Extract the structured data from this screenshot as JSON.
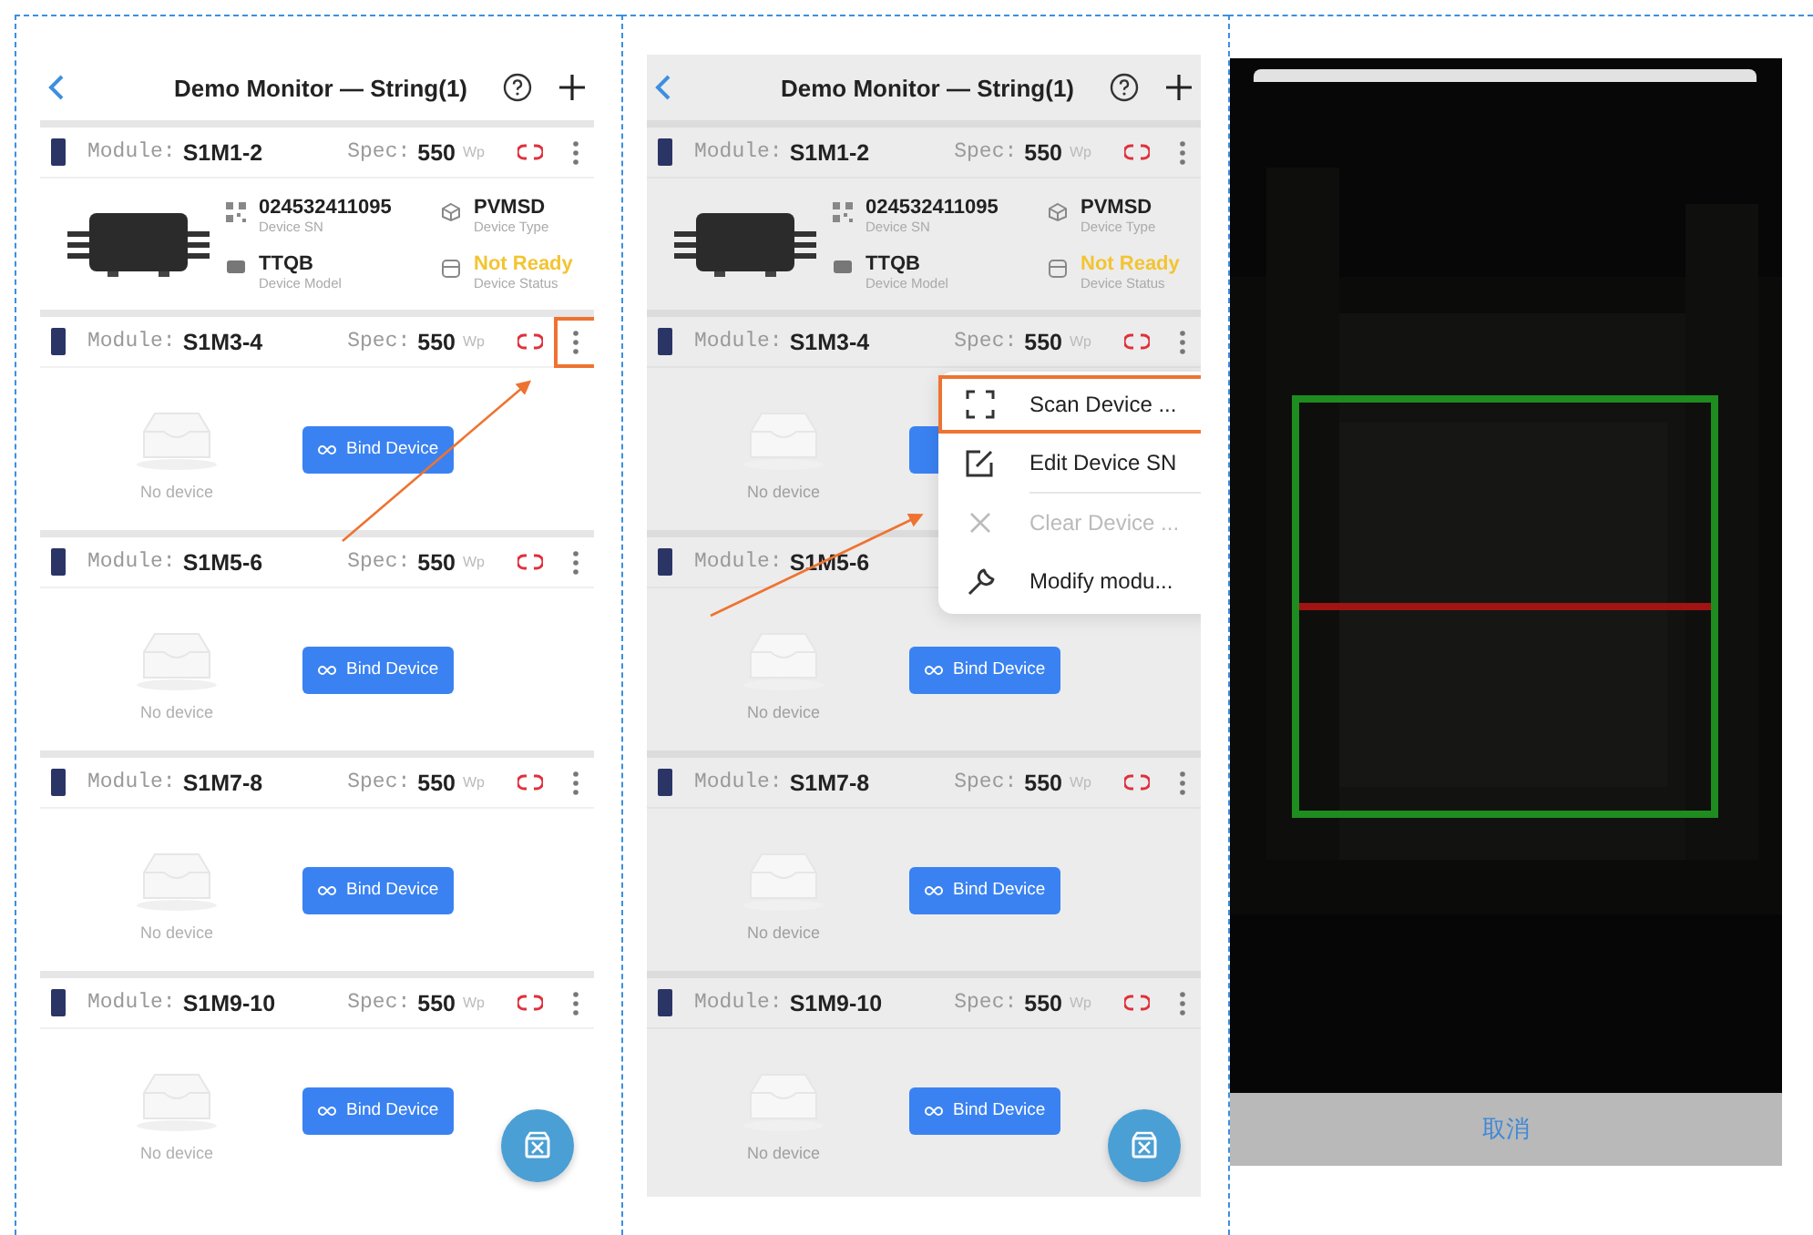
{
  "screens": [
    {
      "kind": "list",
      "title": "Demo Monitor — String(1)",
      "dimmed": false,
      "modules": [
        {
          "label": "Module:",
          "name": "S1M1-2",
          "spec_label": "Spec:",
          "spec": "550",
          "unit": "Wp",
          "bound": true,
          "annotated": false,
          "details": [
            {
              "kind": "sn",
              "value": "024532411095",
              "label": "Device SN",
              "color": "#222222"
            },
            {
              "kind": "type",
              "value": "PVMSD",
              "label": "Device Type",
              "color": "#222222"
            },
            {
              "kind": "model",
              "value": "TTQB",
              "label": "Device Model",
              "color": "#222222"
            },
            {
              "kind": "status",
              "value": "Not Ready",
              "label": "Device Status",
              "color": "#f3c433"
            }
          ]
        },
        {
          "label": "Module:",
          "name": "S1M3-4",
          "spec_label": "Spec:",
          "spec": "550",
          "unit": "Wp",
          "bound": false,
          "annotated": true,
          "empty_text": "No device",
          "bind_label": "Bind Device"
        },
        {
          "label": "Module:",
          "name": "S1M5-6",
          "spec_label": "Spec:",
          "spec": "550",
          "unit": "Wp",
          "bound": false,
          "annotated": false,
          "empty_text": "No device",
          "bind_label": "Bind Device"
        },
        {
          "label": "Module:",
          "name": "S1M7-8",
          "spec_label": "Spec:",
          "spec": "550",
          "unit": "Wp",
          "bound": false,
          "annotated": false,
          "empty_text": "No device",
          "bind_label": "Bind Device"
        },
        {
          "label": "Module:",
          "name": "S1M9-10",
          "spec_label": "Spec:",
          "spec": "550",
          "unit": "Wp",
          "bound": false,
          "annotated": false,
          "empty_text": "No device",
          "bind_label": "Bind Device"
        }
      ]
    },
    {
      "kind": "list",
      "title": "Demo Monitor — String(1)",
      "dimmed": true,
      "modules": [
        {
          "label": "Module:",
          "name": "S1M1-2",
          "spec_label": "Spec:",
          "spec": "550",
          "unit": "Wp",
          "bound": true,
          "annotated": false,
          "details": [
            {
              "kind": "sn",
              "value": "024532411095",
              "label": "Device SN",
              "color": "#222222"
            },
            {
              "kind": "type",
              "value": "PVMSD",
              "label": "Device Type",
              "color": "#222222"
            },
            {
              "kind": "model",
              "value": "TTQB",
              "label": "Device Model",
              "color": "#222222"
            },
            {
              "kind": "status",
              "value": "Not Ready",
              "label": "Device Status",
              "color": "#f3c433"
            }
          ]
        },
        {
          "label": "Module:",
          "name": "S1M3-4",
          "spec_label": "Spec:",
          "spec": "550",
          "unit": "Wp",
          "bound": false,
          "annotated": false,
          "empty_text": "No device"
        },
        {
          "label": "Module:",
          "name": "S1M5-6",
          "bound": false,
          "empty_text": "No device",
          "bind_label": "Bind Device"
        },
        {
          "label": "Module:",
          "name": "S1M7-8",
          "spec_label": "Spec:",
          "spec": "550",
          "unit": "Wp",
          "bound": false,
          "annotated": false,
          "empty_text": "No device",
          "bind_label": "Bind Device"
        },
        {
          "label": "Module:",
          "name": "S1M9-10",
          "spec_label": "Spec:",
          "spec": "550",
          "unit": "Wp",
          "bound": false,
          "annotated": false,
          "empty_text": "No device",
          "bind_label": "Bind Device"
        }
      ],
      "menu": [
        {
          "kind": "scan",
          "label": "Scan Device ...",
          "disabled": false,
          "annotated": true
        },
        {
          "kind": "edit",
          "label": "Edit Device SN",
          "disabled": false,
          "annotated": false
        },
        {
          "kind": "clear",
          "label": "Clear Device ...",
          "disabled": true,
          "annotated": false
        },
        {
          "kind": "wrench",
          "label": "Modify modu...",
          "disabled": false,
          "annotated": false
        }
      ]
    },
    {
      "kind": "scanner",
      "cancel": "取消"
    }
  ]
}
